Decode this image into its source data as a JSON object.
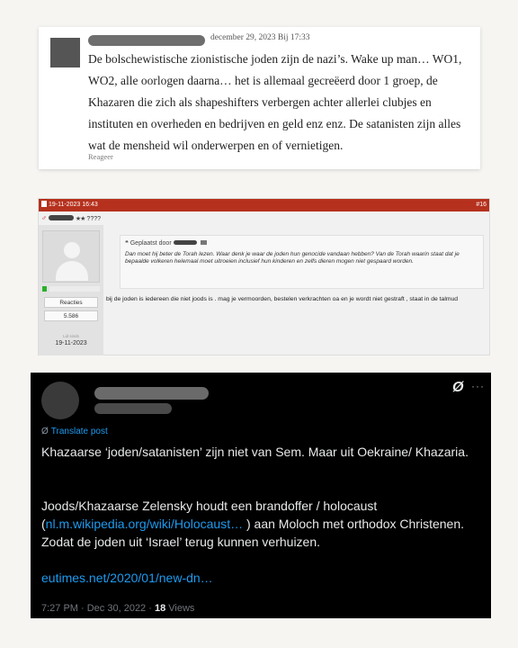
{
  "comment": {
    "date": "december 29, 2023 Bij 17:33",
    "body": "De bolschewistische zionistische joden zijn de nazi’s. Wake up man… WO1, WO2, alle oorlogen daarna… het is allemaal gecreëerd door 1 groep, de Khazaren die zich als shapeshifters verbergen achter allerlei clubjes en instituten en overheden en bedrijven en geld enz enz. De satanisten zijn alles wat de mensheid wil onderwerpen en of vernietigen.",
    "reply_label": "Reageer"
  },
  "forum": {
    "header_date": "19-11-2023 16:43",
    "post_number": "#16",
    "user_title": "????",
    "stars": "★★",
    "reactions_label": "Reacties",
    "reactions_count": "5.586",
    "joined_label": "Lid sinds",
    "joined_date": "19-11-2023",
    "quote_header": "Geplaatst door",
    "quote_text": "Dan moet hij beter de Torah lezen. Waar denk je waar de joden hun genocide vandaan hebben? Van de Torah waarin staat dat je bepaalde volkeren helemaal moet uitroeien inclusief hun kinderen en zelfs dieren mogen niet gespaard worden.",
    "reply_text": "bij de joden is iedereen die niet joods is . mag je vermoorden, bestelen verkrachten oa en je wordt niet gestraft , staat in de talmud"
  },
  "tweet": {
    "translate_label": "Translate post",
    "line1": "Khazaarse ‘joden/satanisten’ zijn niet van Sem. Maar uit Oekraine/ Khazaria.",
    "line2_pre": "Joods/Khazaarse Zelensky houdt een brandoffer / holocaust (",
    "line2_link": "nl.m.wikipedia.org/wiki/Holocaust…",
    "line2_post": " ) aan Moloch met orthodox Christenen. Zodat  de joden uit ‘Israel’ terug kunnen verhuizen.",
    "link2": "eutimes.net/2020/01/new-dn…",
    "time": "7:27 PM · Dec 30, 2022 · ",
    "views_count": "18",
    "views_label": " Views",
    "more_icon": "···"
  }
}
